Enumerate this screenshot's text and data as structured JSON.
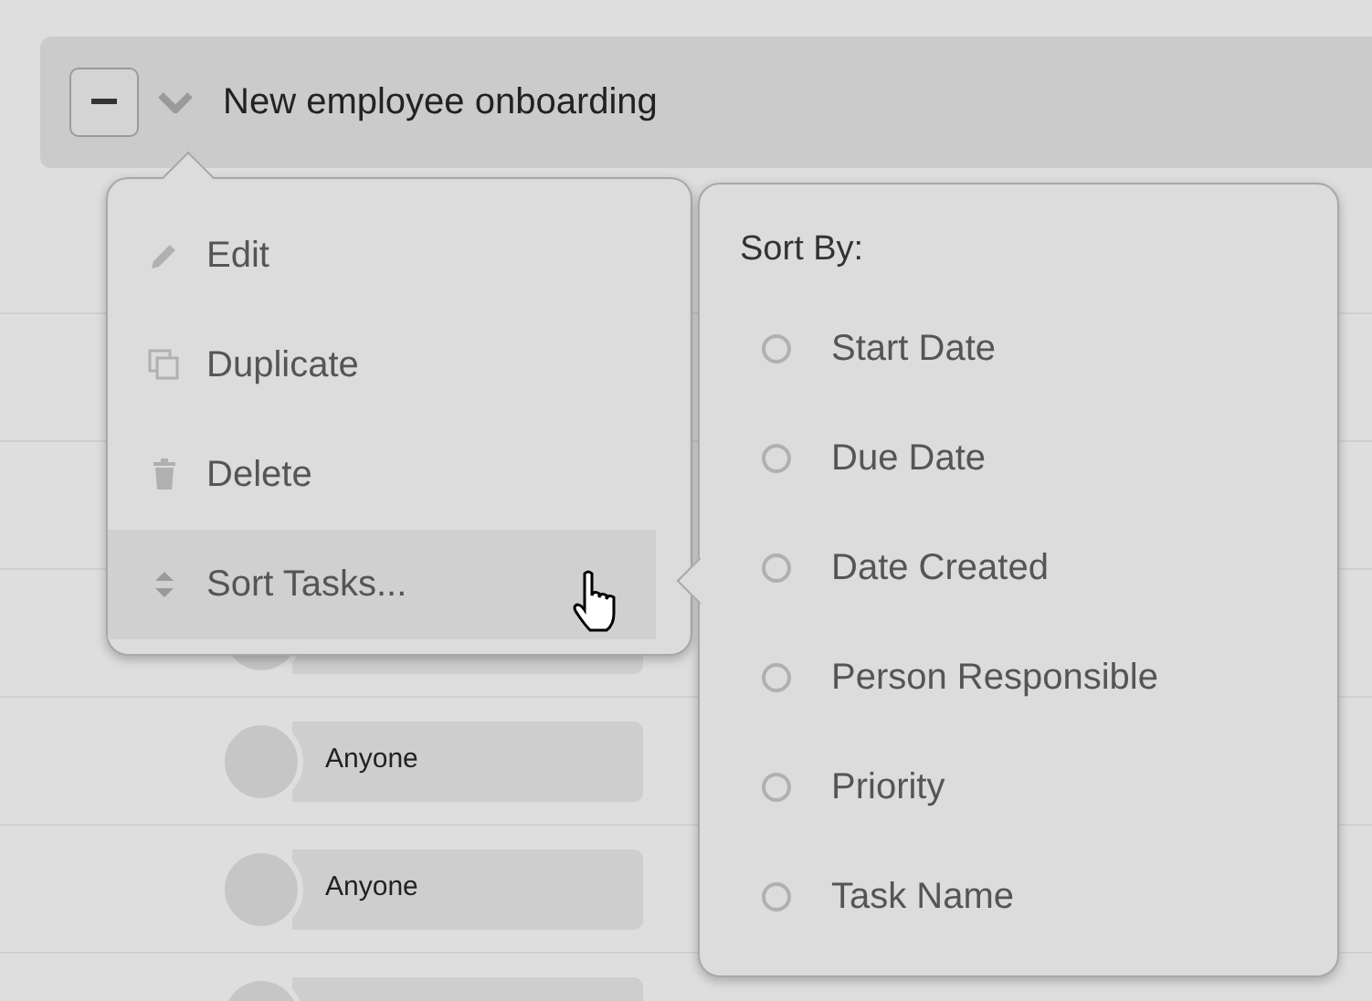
{
  "header": {
    "title": "New employee onboarding"
  },
  "rows": [
    {
      "kind": "blank"
    },
    {
      "kind": "blank"
    },
    {
      "kind": "blank"
    },
    {
      "kind": "person"
    },
    {
      "kind": "person",
      "assignee": "Anyone"
    },
    {
      "kind": "person",
      "assignee": "Anyone"
    },
    {
      "kind": "person"
    }
  ],
  "menu": {
    "items": [
      {
        "kind": "edit",
        "label": "Edit",
        "highlighted": false
      },
      {
        "kind": "duplicate",
        "label": "Duplicate",
        "highlighted": false
      },
      {
        "kind": "delete",
        "label": "Delete",
        "highlighted": false
      },
      {
        "kind": "sort",
        "label": "Sort Tasks...",
        "highlighted": true
      }
    ]
  },
  "submenu": {
    "title": "Sort By:",
    "options": [
      {
        "label": "Start Date",
        "selected": false
      },
      {
        "label": "Due Date",
        "selected": false
      },
      {
        "label": "Date Created",
        "selected": false
      },
      {
        "label": "Person Responsible",
        "selected": false
      },
      {
        "label": "Priority",
        "selected": false
      },
      {
        "label": "Task Name",
        "selected": false
      }
    ]
  }
}
